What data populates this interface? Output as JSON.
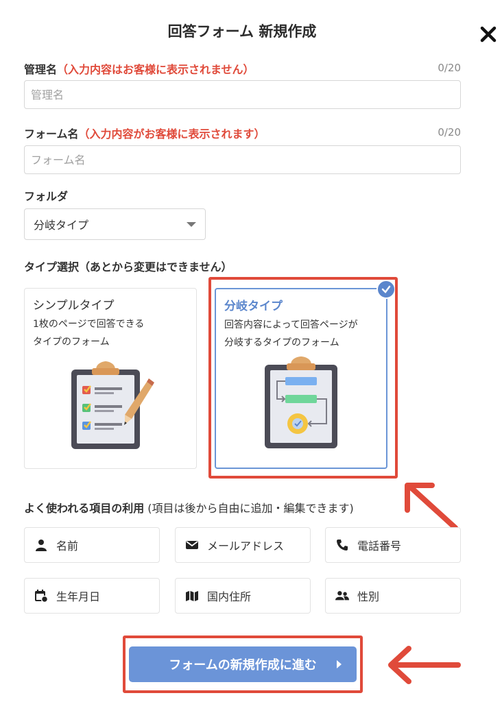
{
  "header": {
    "title": "回答フォーム 新規作成",
    "close_icon": "close-icon"
  },
  "admin_name": {
    "label": "管理名",
    "note": "（入力内容はお客様に表示されません）",
    "counter": "0/20",
    "placeholder": "管理名",
    "value": ""
  },
  "form_name": {
    "label": "フォーム名",
    "note": "（入力内容がお客様に表示されます）",
    "counter": "0/20",
    "placeholder": "フォーム名",
    "value": ""
  },
  "folder": {
    "label": "フォルダ",
    "selected": "分岐タイプ"
  },
  "type_select": {
    "label": "タイプ選択（あとから変更はできません）",
    "options": [
      {
        "title": "シンプルタイプ",
        "desc1": "1枚のページで回答できる",
        "desc2": "タイプのフォーム",
        "selected": false
      },
      {
        "title": "分岐タイプ",
        "desc1": "回答内容によって回答ページが",
        "desc2": "分岐するタイプのフォーム",
        "selected": true
      }
    ]
  },
  "common_items": {
    "label_bold": "よく使われる項目の利用",
    "label_note": " (項目は後から自由に追加・編集できます)",
    "items": [
      {
        "label": "名前",
        "icon": "person-icon"
      },
      {
        "label": "メールアドレス",
        "icon": "envelope-icon"
      },
      {
        "label": "電話番号",
        "icon": "phone-icon"
      },
      {
        "label": "生年月日",
        "icon": "calendar-icon"
      },
      {
        "label": "国内住所",
        "icon": "map-icon"
      },
      {
        "label": "性別",
        "icon": "users-icon"
      }
    ]
  },
  "submit": {
    "label": "フォームの新規作成に進む"
  },
  "colors": {
    "accent": "#6b94d8",
    "selected_text": "#5b86cc",
    "note": "#e04a3a",
    "annotation": "#e04a3a"
  }
}
